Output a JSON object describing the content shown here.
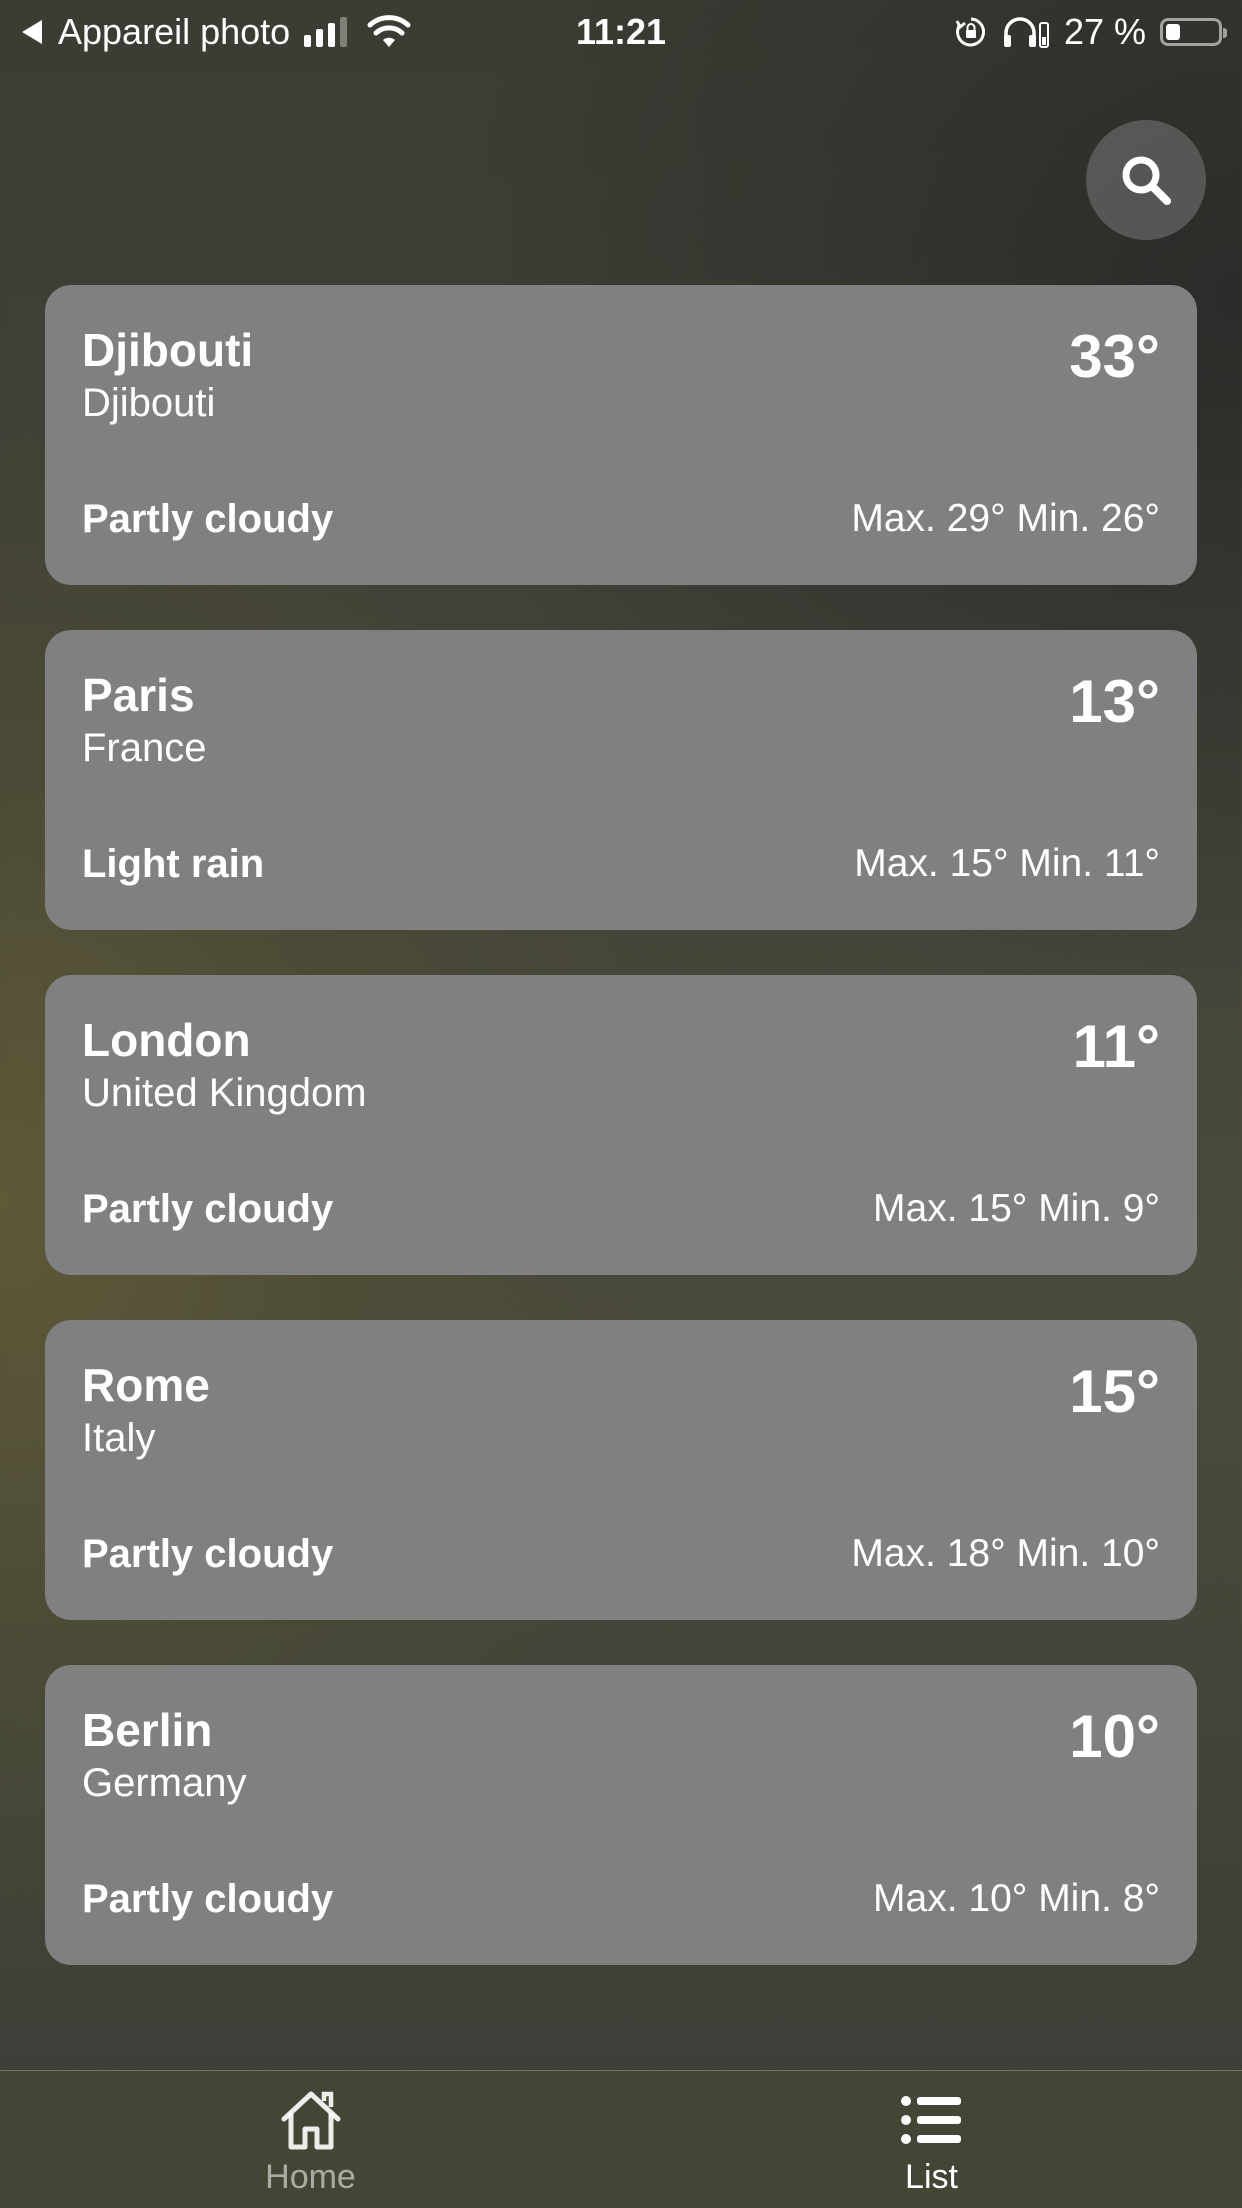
{
  "status_bar": {
    "back_app": "Appareil photo",
    "time": "11:21",
    "battery_text": "27 %",
    "battery_level": 0.27
  },
  "search": {
    "icon": "search-icon"
  },
  "cities": [
    {
      "name": "Djibouti",
      "country": "Djibouti",
      "temperature": "33°",
      "condition": "Partly cloudy",
      "minmax": "Max. 29° Min. 26°"
    },
    {
      "name": "Paris",
      "country": "France",
      "temperature": "13°",
      "condition": "Light rain",
      "minmax": "Max. 15° Min. 11°"
    },
    {
      "name": "London",
      "country": "United Kingdom",
      "temperature": "11°",
      "condition": "Partly cloudy",
      "minmax": "Max. 15° Min. 9°"
    },
    {
      "name": "Rome",
      "country": "Italy",
      "temperature": "15°",
      "condition": "Partly cloudy",
      "minmax": "Max. 18° Min. 10°"
    },
    {
      "name": "Berlin",
      "country": "Germany",
      "temperature": "10°",
      "condition": "Partly cloudy",
      "minmax": "Max. 10° Min. 8°"
    }
  ],
  "tab_bar": {
    "home_label": "Home",
    "list_label": "List",
    "active": "List"
  },
  "colors": {
    "card_background": "#808080",
    "tab_bar_background": "#454535"
  }
}
